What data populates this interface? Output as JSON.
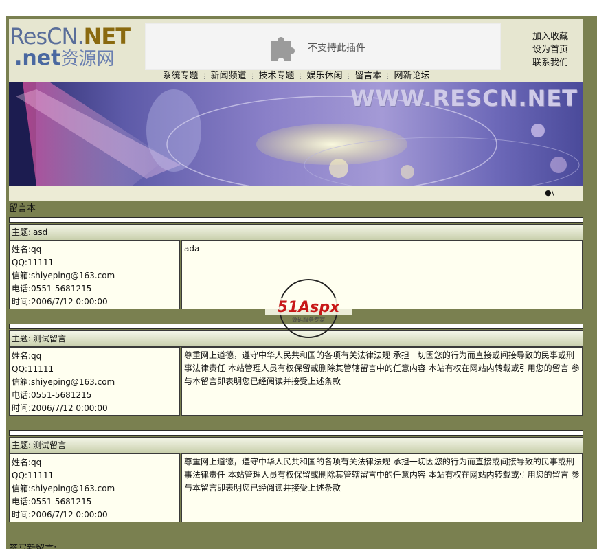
{
  "logo": {
    "line1_a": "ResCN.",
    "line1_b": "NET",
    "line2_a": ".net",
    "line2_b": "资源网"
  },
  "plugin": {
    "message": "不支持此插件"
  },
  "quicklinks": [
    "加入收藏",
    "设为首页",
    "联系我们"
  ],
  "nav": [
    "系统专题",
    "新闻频道",
    "技术专题",
    "娱乐休闲",
    "留言本",
    "网新论坛"
  ],
  "nav_separator": "⋮",
  "banner": {
    "url_text": "WWW.RESCN.NET"
  },
  "banner_footer_mark": "●\\",
  "page": {
    "section_title": "留言本",
    "sign_title": "签写新留言:"
  },
  "labels": {
    "subject": "主题:",
    "name": "姓名:",
    "qq": "QQ:",
    "email": "信箱:",
    "phone": "电话:",
    "time": "时间:"
  },
  "messages": [
    {
      "subject": "asd",
      "name": "qq",
      "qq": "11111",
      "email": "shiyeping@163.com",
      "phone": "0551-5681215",
      "time": "2006/7/12 0:00:00",
      "content": "ada"
    },
    {
      "subject": "测试留言",
      "name": "qq",
      "qq": "11111",
      "email": "shiyeping@163.com",
      "phone": "0551-5681215",
      "time": "2006/7/12 0:00:00",
      "content": "尊重网上道德，遵守中华人民共和国的各项有关法律法规 承担一切因您的行为而直接或间接导致的民事或刑事法律责任 本站管理人员有权保留或删除其管辖留言中的任意内容 本站有权在网站内转载或引用您的留言 参与本留言即表明您已经阅读并接受上述条款"
    },
    {
      "subject": "测试留言",
      "name": "qq",
      "qq": "11111",
      "email": "shiyeping@163.com",
      "phone": "0551-5681215",
      "time": "2006/7/12 0:00:00",
      "content": "尊重网上道德，遵守中华人民共和国的各项有关法律法规 承担一切因您的行为而直接或间接导致的民事或刑事法律责任 本站管理人员有权保留或删除其管辖留言中的任意内容 本站有权在网站内转载或引用您的留言 参与本留言即表明您已经阅读并接受上述条款"
    }
  ],
  "watermark": {
    "brand": "51Aspx",
    "tagline": "源码服务专家"
  },
  "colors": {
    "frame": "#7a8050",
    "header_bg": "#e6e6d0",
    "cell_bg": "#fffff0",
    "subject_bar": "#c9d0ad"
  }
}
